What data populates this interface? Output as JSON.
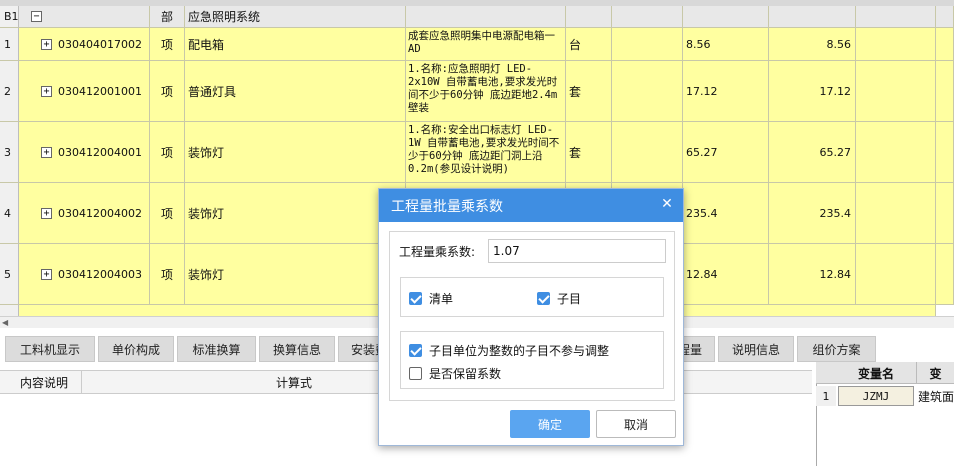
{
  "table": {
    "group_row": {
      "num": "B1",
      "toggle": "−",
      "type": "部",
      "name": "应急照明系统"
    },
    "rows": [
      {
        "num": "1",
        "code": "030404017002",
        "type": "项",
        "name": "配电箱",
        "desc": "成套应急照明集中电源配电箱一AD",
        "unit": "台",
        "qty": "8.56",
        "total": "8.56"
      },
      {
        "num": "2",
        "code": "030412001001",
        "type": "项",
        "name": "普通灯具",
        "desc": "1.名称:应急照明灯 LED-2x10W 自带蓄电池,要求发光时间不少于60分钟 底边距地2.4m壁装",
        "unit": "套",
        "qty": "17.12",
        "total": "17.12"
      },
      {
        "num": "3",
        "code": "030412004001",
        "type": "项",
        "name": "装饰灯",
        "desc": "1.名称:安全出口标志灯 LED-1W 自带蓄电池,要求发光时间不少于60分钟 底边距门洞上沿0.2m(参见设计说明)",
        "unit": "套",
        "qty": "65.27",
        "total": "65.27"
      },
      {
        "num": "4",
        "code": "030412004002",
        "type": "项",
        "name": "装饰灯",
        "desc": "",
        "unit": "",
        "qty": "235.4",
        "total": "235.4"
      },
      {
        "num": "5",
        "code": "030412004003",
        "type": "项",
        "name": "装饰灯",
        "desc": "",
        "unit": "",
        "qty": "12.84",
        "total": "12.84"
      }
    ],
    "expand_symbol": "+"
  },
  "tabs": [
    "工料机显示",
    "单价构成",
    "标准换算",
    "换算信息",
    "安装费",
    "程量",
    "说明信息",
    "组价方案"
  ],
  "bottom_left": {
    "col_desc": "内容说明",
    "col_formula": "计算式"
  },
  "bottom_right": {
    "col_var": "变量名",
    "col_var2": "变",
    "row_num": "1",
    "var_name": "JZMJ",
    "var_desc": "建筑面"
  },
  "dialog": {
    "title": "工程量批量乘系数",
    "close_glyph": "✕",
    "factor_label": "工程量乘系数:",
    "factor_value": "1.07",
    "opt_list": "清单",
    "opt_sub": "子目",
    "opt_int": "子目单位为整数的子目不参与调整",
    "opt_keep": "是否保留系数",
    "ok": "确定",
    "cancel": "取消"
  },
  "colors": {
    "row_yellow": "#ffffa0",
    "dialog_blue": "#3f8ee2"
  },
  "icons": {
    "expand": "plus-box-icon",
    "collapse": "minus-box-icon",
    "close": "close-icon",
    "scroll_left": "arrow-left-icon"
  }
}
